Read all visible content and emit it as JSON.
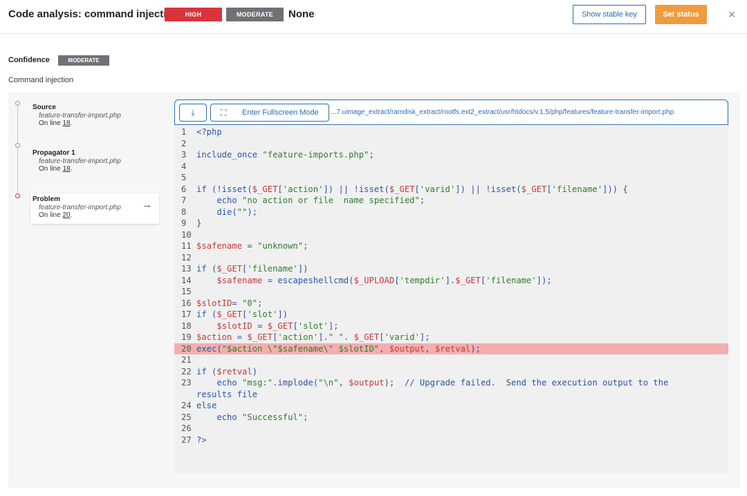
{
  "header": {
    "title": "Code analysis: command injection",
    "severity_high": "HIGH",
    "severity_moderate": "MODERATE",
    "severity_none": "None",
    "show_stable_key": "Show stable key",
    "set_status": "Set status",
    "close": "×"
  },
  "confidence": {
    "label": "Confidence",
    "value": "MODERATE"
  },
  "category": "Command injection",
  "steps": [
    {
      "name": "Source",
      "file": "feature-transfer-import.php",
      "line_prefix": "On line ",
      "line": "18",
      "line_suffix": "."
    },
    {
      "name": "Propagator 1",
      "file": "feature-transfer-import.php",
      "line_prefix": "On line ",
      "line": "18",
      "line_suffix": "."
    },
    {
      "name": "Problem",
      "file": "feature-transfer-import.php",
      "line_prefix": "On line ",
      "line": "20",
      "line_suffix": "."
    }
  ],
  "toolbar": {
    "fullscreen_label": "Enter Fullscreen Mode",
    "path": "...7.uimage_extract/ramdisk_extract/rootfs.ext2_extract/usr/htdocs/v.1.5/php/features/feature-transfer-import.php"
  },
  "code": {
    "highlight_line": 20,
    "lines": [
      {
        "n": "1",
        "html": "&lt;?php"
      },
      {
        "n": "2",
        "html": ""
      },
      {
        "n": "3",
        "html": "include_once <span class='str'>\"feature-imports.php\"</span>;"
      },
      {
        "n": "4",
        "html": ""
      },
      {
        "n": "5",
        "html": ""
      },
      {
        "n": "6",
        "html": "if (!isset(<span class='var'>$_GET</span>[<span class='str'>'action'</span>]) || !isset(<span class='var'>$_GET</span>[<span class='str'>'varid'</span>]) || !isset(<span class='var'>$_GET</span>[<span class='str'>'filename'</span>])) {"
      },
      {
        "n": "7",
        "html": "    echo <span class='str'>\"no action or file  name specified\"</span>;"
      },
      {
        "n": "8",
        "html": "    die(<span class='str'>\"\"</span>);"
      },
      {
        "n": "9",
        "html": "}"
      },
      {
        "n": "10",
        "html": ""
      },
      {
        "n": "11",
        "html": "<span class='var'>$safename</span> = <span class='str'>\"unknown\"</span>;"
      },
      {
        "n": "12",
        "html": ""
      },
      {
        "n": "13",
        "html": "if (<span class='var'>$_GET</span>[<span class='str'>'filename'</span>])"
      },
      {
        "n": "14",
        "html": "    <span class='var'>$safename</span> = escapeshellcmd(<span class='var'>$_UPLOAD</span>[<span class='str'>'tempdir'</span>].<span class='var'>$_GET</span>[<span class='str'>'filename'</span>]);"
      },
      {
        "n": "15",
        "html": ""
      },
      {
        "n": "16",
        "html": "<span class='var'>$slotID</span>= <span class='str'>\"0\"</span>;"
      },
      {
        "n": "17",
        "html": "if (<span class='var'>$_GET</span>[<span class='str'>'slot'</span>])"
      },
      {
        "n": "18",
        "html": "    <span class='var'>$slotID</span> = <span class='var'>$_GET</span>[<span class='str'>'slot'</span>];"
      },
      {
        "n": "19",
        "html": "<span class='var'>$action</span> = <span class='var'>$_GET</span>[<span class='str'>'action'</span>].<span class='str'>\" \"</span>. <span class='var'>$_GET</span>[<span class='str'>'varid'</span>];"
      },
      {
        "n": "20",
        "html": "exec(<span class='str'>\"$action \\\"$safename\\\" $slotID\"</span>, <span class='var'>$output</span>, <span class='var'>$retval</span>);"
      },
      {
        "n": "21",
        "html": ""
      },
      {
        "n": "22",
        "html": "if (<span class='var'>$retval</span>)"
      },
      {
        "n": "23",
        "html": "    echo <span class='str'>\"msg:\"</span>.implode(<span class='str'>\"\\n\"</span>, <span class='var'>$output</span>);  // Upgrade failed.  Send the execution output to the"
      },
      {
        "n": "",
        "html": "results file"
      },
      {
        "n": "24",
        "html": "else"
      },
      {
        "n": "25",
        "html": "    echo <span class='str'>\"Successful\"</span>;"
      },
      {
        "n": "26",
        "html": ""
      },
      {
        "n": "27",
        "html": "?&gt;"
      }
    ]
  },
  "icons": {
    "download": "download-icon",
    "fullscreen": "expand-icon",
    "close": "close-icon",
    "arrow": "arrow-right-icon"
  },
  "colors": {
    "high": "#d9343c",
    "moderate": "#6e7276",
    "accent": "#2a6bb1",
    "status_button": "#f09b3c",
    "highlight": "#f3aeae"
  }
}
